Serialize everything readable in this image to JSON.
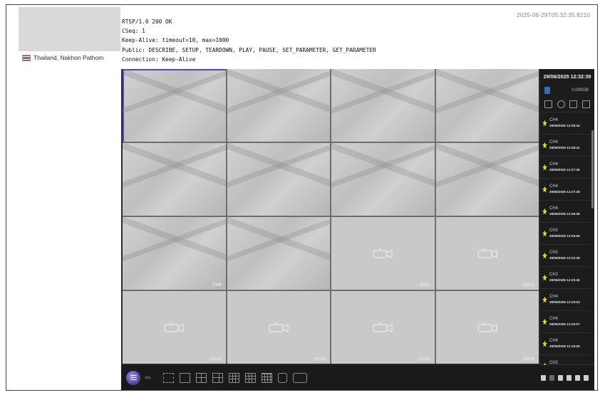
{
  "header": {
    "location": "Thailand, Nakhon Pathom",
    "timestamp": "2025-06-29T05:32:35.8210"
  },
  "rtsp_response": [
    "RTSP/1.0 200 OK",
    "CSeq: 1",
    "Keep-Alive: timeout=10, max=1000",
    "Public: DESCRIBE, SETUP, TEARDOWN, PLAY, PAUSE, SET_PARAMETER, GET_PARAMETER",
    "Connection: Keep-Alive"
  ],
  "dvr": {
    "datetime": "29/06/2025 12:32:39",
    "hdd_label": "0.000GB",
    "channels": [
      {
        "label": ""
      },
      {
        "label": ""
      },
      {
        "label": ""
      },
      {
        "label": ""
      },
      {
        "label": ""
      },
      {
        "label": ""
      },
      {
        "label": ""
      },
      {
        "label": ""
      },
      {
        "label": "CH9"
      },
      {
        "label": ""
      },
      {
        "label": "CH11"
      },
      {
        "label": "CH12"
      },
      {
        "label": "CH13"
      },
      {
        "label": "CH14"
      },
      {
        "label": "CH15"
      },
      {
        "label": "CH16"
      }
    ],
    "events": [
      {
        "channel": "CH4",
        "time": "29/06/2025 12:28:44"
      },
      {
        "channel": "CH4",
        "time": "29/06/2025 12:28:41"
      },
      {
        "channel": "CH4",
        "time": "29/06/2025 12:27:35"
      },
      {
        "channel": "CH4",
        "time": "29/06/2025 12:27:28"
      },
      {
        "channel": "CH4",
        "time": "29/06/2025 12:26:38"
      },
      {
        "channel": "CH2",
        "time": "29/06/2025 12:25:59"
      },
      {
        "channel": "CH2",
        "time": "29/06/2025 12:22:38"
      },
      {
        "channel": "CH2",
        "time": "29/06/2025 12:20:45"
      },
      {
        "channel": "CH4",
        "time": "29/06/2025 12:20:04"
      },
      {
        "channel": "CH4",
        "time": "29/06/2025 12:20:07"
      },
      {
        "channel": "CH4",
        "time": "29/06/2025 12:19:56"
      },
      {
        "channel": "CH2",
        "time": "29/06/2025 12:18:59"
      }
    ],
    "taskbar": {
      "menu_label": "seq"
    }
  }
}
